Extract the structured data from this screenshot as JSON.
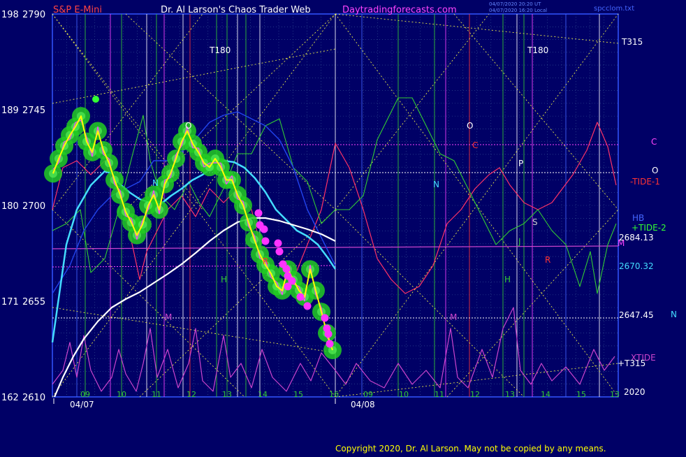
{
  "header": {
    "instrument": "S&P E-Mini",
    "title": "Dr. Al Larson's Chaos Trader Web",
    "site": "Daytradingforecasts.com",
    "stamp_1": "04/07/2020 20:20 UT",
    "stamp_2": "04/07/2020 16:20 Local",
    "file": "spcclom.txt"
  },
  "footer": {
    "copyright": "Copyright 2020, Dr. Al Larson. May not be copied by any means."
  },
  "colors": {
    "background": "#000066",
    "price_bars": "#ffff00",
    "moving_avg_fast": "#44ddff",
    "moving_avg_slow": "#ffffff",
    "tide": "#ff3366",
    "xtide": "#cc44cc",
    "green_field": "#22cc22"
  },
  "chart_data": {
    "type": "line",
    "title": "S&P E-Mini",
    "ylim": [
      2610,
      2790
    ],
    "y_ticks": [
      {
        "deg": "198",
        "price": "2790",
        "value": 2790
      },
      {
        "deg": "189",
        "price": "2745",
        "value": 2745
      },
      {
        "deg": "180",
        "price": "2700",
        "value": 2700
      },
      {
        "deg": "171",
        "price": "2655",
        "value": 2655
      },
      {
        "deg": "162",
        "price": "2610",
        "value": 2610
      }
    ],
    "x_hours": [
      "09",
      "10",
      "11",
      "12",
      "13",
      "14",
      "15",
      "16",
      "09",
      "10",
      "11",
      "12",
      "13",
      "14",
      "15",
      "13"
    ],
    "x_dates": [
      "04/07",
      "04/08"
    ],
    "price_levels": [
      {
        "label": "2684.13",
        "value": 2684.13
      },
      {
        "label": "2670.32",
        "value": 2670.32
      },
      {
        "label": "2647.45",
        "value": 2647.45
      }
    ],
    "right_labels": [
      "T315",
      "C",
      "O",
      "-TIDE-1",
      "HB",
      "+TIDE-2",
      "M",
      "N",
      "XTIDE",
      "+T315",
      "2020"
    ],
    "in_chart_labels": [
      "T180",
      "T180",
      "O",
      "N",
      "H",
      "R",
      "O",
      "C",
      "P",
      "N",
      "J",
      "S",
      "R",
      "H",
      "M",
      "M"
    ],
    "price_series": [
      2715,
      2722,
      2728,
      2733,
      2737,
      2742,
      2730,
      2725,
      2735,
      2726,
      2720,
      2712,
      2705,
      2697,
      2692,
      2686,
      2691,
      2700,
      2705,
      2698,
      2710,
      2715,
      2722,
      2730,
      2735,
      2729,
      2725,
      2720,
      2718,
      2722,
      2718,
      2712,
      2712,
      2705,
      2700,
      2692,
      2684,
      2677,
      2672,
      2668,
      2662,
      2660,
      2670,
      2665,
      2660,
      2657,
      2670,
      2660,
      2650,
      2640,
      2632
    ],
    "series": [
      {
        "name": "price",
        "values": "price_series"
      }
    ]
  }
}
